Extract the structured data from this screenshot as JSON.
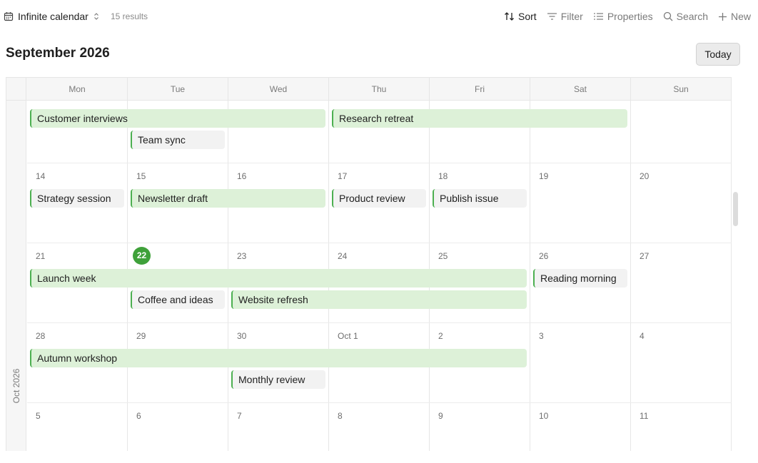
{
  "header": {
    "database_title": "Infinite calendar",
    "result_count": "15 results",
    "actions": [
      {
        "id": "sort",
        "label": "Sort",
        "icon": "sort-icon",
        "active": true
      },
      {
        "id": "filter",
        "label": "Filter",
        "icon": "filter-icon",
        "active": false
      },
      {
        "id": "properties",
        "label": "Properties",
        "icon": "properties-icon",
        "active": false
      },
      {
        "id": "search",
        "label": "Search",
        "icon": "search-icon",
        "active": false
      },
      {
        "id": "new",
        "label": "New",
        "icon": "plus-icon",
        "active": false
      }
    ]
  },
  "calendar": {
    "month_title": "September 2026",
    "today_label": "Today",
    "side_label": "Oct 2026",
    "weekdays": [
      "Mon",
      "Tue",
      "Wed",
      "Thu",
      "Fri",
      "Sat",
      "Sun"
    ],
    "weeks": [
      {
        "days": [
          "",
          "",
          "",
          "",
          "",
          "",
          ""
        ]
      },
      {
        "days": [
          "14",
          "15",
          "16",
          "17",
          "18",
          "19",
          "20"
        ]
      },
      {
        "days": [
          "21",
          "22",
          "23",
          "24",
          "25",
          "26",
          "27"
        ]
      },
      {
        "days": [
          "28",
          "29",
          "30",
          "Oct 1",
          "2",
          "3",
          "4"
        ]
      },
      {
        "days": [
          "5",
          "6",
          "7",
          "8",
          "9",
          "10",
          "11"
        ]
      }
    ],
    "today_date": "22",
    "events": [
      {
        "title": "Customer interviews",
        "week": 0,
        "start": 0,
        "span": 3,
        "lane": 0,
        "style": "green"
      },
      {
        "title": "Research retreat",
        "week": 0,
        "start": 3,
        "span": 3,
        "lane": 0,
        "style": "green"
      },
      {
        "title": "Team sync",
        "week": 0,
        "start": 1,
        "span": 1,
        "lane": 1,
        "style": "grey"
      },
      {
        "title": "Strategy session",
        "week": 1,
        "start": 0,
        "span": 1,
        "lane": 0,
        "style": "grey"
      },
      {
        "title": "Newsletter draft",
        "week": 1,
        "start": 1,
        "span": 2,
        "lane": 0,
        "style": "green"
      },
      {
        "title": "Product review",
        "week": 1,
        "start": 3,
        "span": 1,
        "lane": 0,
        "style": "grey"
      },
      {
        "title": "Publish issue",
        "week": 1,
        "start": 4,
        "span": 1,
        "lane": 0,
        "style": "grey"
      },
      {
        "title": "Launch week",
        "week": 2,
        "start": 0,
        "span": 5,
        "lane": 0,
        "style": "green"
      },
      {
        "title": "Reading morning",
        "week": 2,
        "start": 5,
        "span": 1,
        "lane": 0,
        "style": "grey"
      },
      {
        "title": "Coffee and ideas",
        "week": 2,
        "start": 1,
        "span": 1,
        "lane": 1,
        "style": "grey"
      },
      {
        "title": "Website refresh",
        "week": 2,
        "start": 2,
        "span": 3,
        "lane": 1,
        "style": "green"
      },
      {
        "title": "Autumn workshop",
        "week": 3,
        "start": 0,
        "span": 5,
        "lane": 0,
        "style": "green"
      },
      {
        "title": "Monthly review",
        "week": 3,
        "start": 2,
        "span": 1,
        "lane": 1,
        "style": "grey"
      }
    ]
  },
  "colors": {
    "accent": "#3fa13a",
    "event_green": "#ddf1d8",
    "event_grey": "#f2f2f2",
    "event_border": "#4caf50"
  }
}
